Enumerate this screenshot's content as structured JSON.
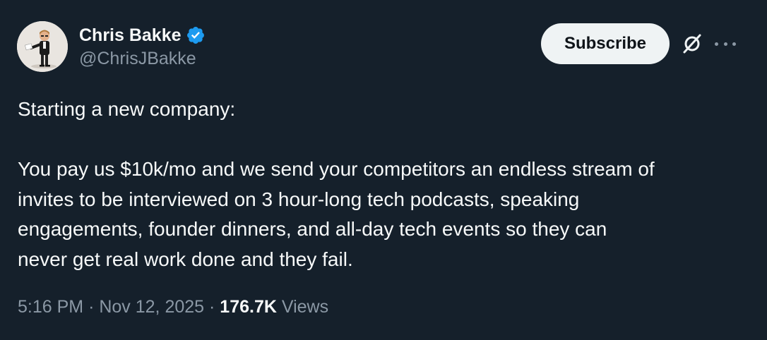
{
  "author": {
    "display_name": "Chris Bakke",
    "handle": "@ChrisJBakke",
    "verified": true,
    "verified_color": "#1d9bf0"
  },
  "actions": {
    "subscribe_label": "Subscribe",
    "grok_icon": "grok-icon",
    "more_icon": "more-options-icon"
  },
  "tweet": {
    "paragraph_1": "Starting a new company:",
    "lines": [
      "You pay us $10k/mo and we send your competitors an endless stream of",
      "invites to be interviewed on 3 hour-long tech podcasts, speaking",
      "engagements, founder dinners, and all-day tech events so they can",
      "never get real work done and they fail."
    ]
  },
  "meta": {
    "time": "5:16 PM",
    "separator": "·",
    "date": "Nov 12, 2025",
    "views_count": "176.7K",
    "views_label": "Views"
  },
  "colors": {
    "background": "#15202b",
    "text": "#f7f9f9",
    "secondary_text": "#8b98a5",
    "button_bg": "#eff3f4"
  }
}
